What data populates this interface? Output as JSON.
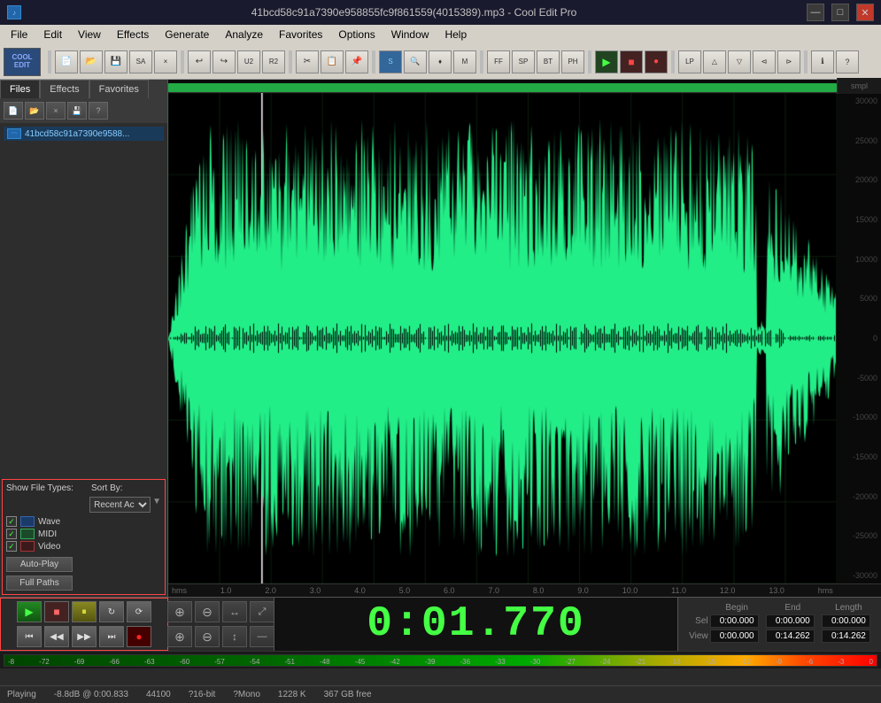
{
  "titlebar": {
    "title": "41bcd58c91a7390e958855fc9f861559(4015389).mp3 - Cool Edit Pro",
    "minimize": "—",
    "maximize": "□",
    "close": "✕"
  },
  "menubar": {
    "items": [
      "File",
      "Edit",
      "View",
      "Effects",
      "Generate",
      "Analyze",
      "Favorites",
      "Options",
      "Window",
      "Help"
    ]
  },
  "tabs": {
    "files": "Files",
    "effects": "Effects",
    "favorites": "Favorites"
  },
  "left_panel": {
    "file_name": "41bcd58c91a7390e9588...",
    "show_label": "Show File Types:",
    "sort_label": "Sort By:",
    "sort_value": "Recent Ac",
    "auto_play": "Auto-Play",
    "full_paths": "Full Paths",
    "types": [
      {
        "name": "Wave",
        "checked": true
      },
      {
        "name": "MIDI",
        "checked": true
      },
      {
        "name": "Video",
        "checked": true
      }
    ]
  },
  "timeline": {
    "markers": [
      "hms",
      "1.0",
      "2.0",
      "3.0",
      "4.0",
      "5.0",
      "6.0",
      "7.0",
      "8.0",
      "9.0",
      "10.0",
      "11.0",
      "12.0",
      "13.0",
      "hms"
    ]
  },
  "y_axis": {
    "labels": [
      "smpl",
      "30000",
      "25000",
      "20000",
      "15000",
      "10000",
      "5000",
      "0",
      "-5000",
      "-10000",
      "-15000",
      "-20000",
      "-25000",
      "-30000"
    ]
  },
  "transport": {
    "play": "▶",
    "stop": "■",
    "pause": "⏸",
    "loop": "↻",
    "repeat": "⟳",
    "rewind_start": "⏮",
    "rewind": "◀◀",
    "forward": "▶▶",
    "forward_end": "⏭",
    "record": "●"
  },
  "time_display": {
    "value": "0:01.770"
  },
  "zoom": {
    "zoom_in_h": "⊕",
    "zoom_out_h": "⊖",
    "zoom_fit_h": "↔",
    "zoom_in_v": "⊕",
    "zoom_out_v": "⊖",
    "zoom_fit_v": "↕",
    "zoom_full": "⤢"
  },
  "position": {
    "sel_label": "Sel",
    "view_label": "View",
    "begin_label": "Begin",
    "end_label": "End",
    "length_label": "Length",
    "sel_begin": "0:00.000",
    "sel_end": "0:00.000",
    "sel_length": "0:00.000",
    "view_begin": "0:00.000",
    "view_end": "0:14.262",
    "view_length": "0:14.262"
  },
  "vu_meter": {
    "labels": [
      "-8",
      "-72",
      "-69",
      "-66",
      "-63",
      "-60",
      "-57",
      "-54",
      "-51",
      "-48",
      "-45",
      "-42",
      "-39",
      "-36",
      "-33",
      "-30",
      "-27",
      "-24",
      "-21",
      "-18",
      "-15",
      "-12",
      "-9",
      "-6",
      "-3",
      "0"
    ]
  },
  "statusbar": {
    "playing": "Playing",
    "db": "-8.8dB",
    "at": "@",
    "time": "0:00.833",
    "sample_rate": "44100",
    "bit_depth": "?16-bit",
    "channels": "?Mono",
    "bitrate": "1228 K",
    "free": "367 GB free"
  }
}
